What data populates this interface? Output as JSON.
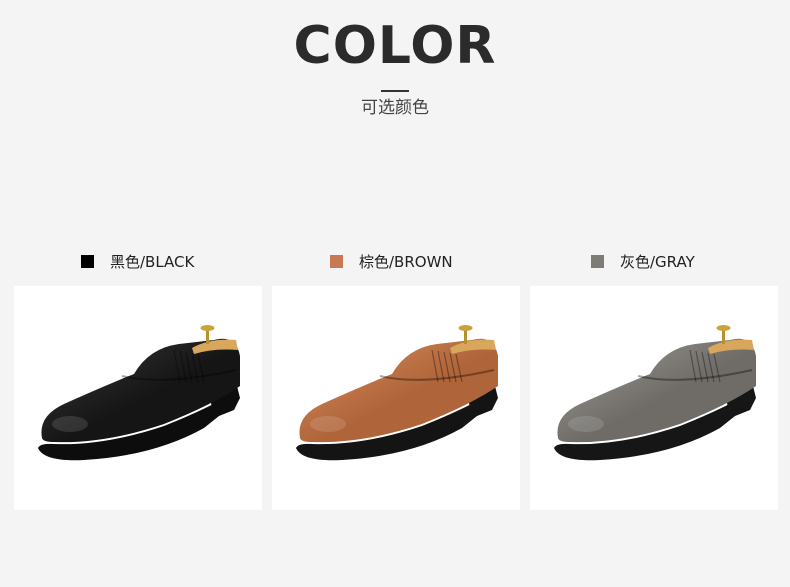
{
  "header": {
    "title": "COLOR",
    "subtitle": "可选颜色"
  },
  "colors": [
    {
      "label": "黑色/BLACK",
      "swatch": "#000000",
      "upper": "#151515",
      "upper_hi": "#3a3a3a",
      "sole": "#0d0d0d"
    },
    {
      "label": "棕色/BROWN",
      "swatch": "#c77a52",
      "upper": "#b0643a",
      "upper_hi": "#d6925e",
      "sole": "#141414"
    },
    {
      "label": "灰色/GRAY",
      "swatch": "#7f7b77",
      "upper": "#6f6c68",
      "upper_hi": "#a29f9a",
      "sole": "#161616"
    }
  ]
}
